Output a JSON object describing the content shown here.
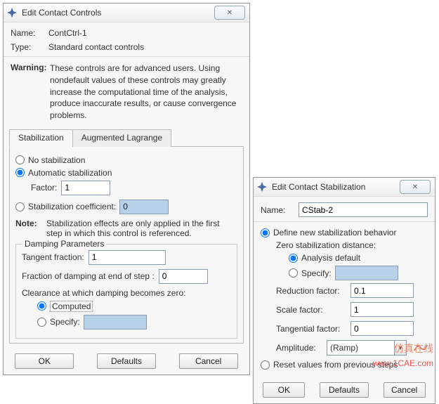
{
  "left": {
    "title": "Edit Contact Controls",
    "name_label": "Name:",
    "name_value": "ContCtrl-1",
    "type_label": "Type:",
    "type_value": "Standard contact controls",
    "warning_label": "Warning:",
    "warning_text": "These controls are for advanced users. Using nondefault values of these controls may greatly increase the computational time of the analysis, produce inaccurate results, or cause convergence problems.",
    "tabs": {
      "stabilization": "Stabilization",
      "augmented": "Augmented Lagrange"
    },
    "opt_none": "No stabilization",
    "opt_auto": "Automatic stabilization",
    "factor_label": "Factor:",
    "factor_value": "1",
    "opt_coef": "Stabilization coefficient:",
    "coef_value": "0",
    "note_label": "Note:",
    "note_text": "Stabilization effects are only applied in the first step in which this control is referenced.",
    "damping_group": "Damping Parameters",
    "tangent_label": "Tangent fraction:",
    "tangent_value": "1",
    "fraction_label": "Fraction of damping at end of step :",
    "fraction_value": "0",
    "clearance_label": "Clearance at which damping becomes zero:",
    "clr_computed": "Computed",
    "clr_specify": "Specify:",
    "clr_specify_value": "",
    "btn_ok": "OK",
    "btn_defaults": "Defaults",
    "btn_cancel": "Cancel"
  },
  "right": {
    "title": "Edit Contact Stabilization",
    "name_label": "Name:",
    "name_value": "CStab-2",
    "opt_define": "Define new stabilization behavior",
    "zero_label": "Zero stabilization distance:",
    "zero_default": "Analysis default",
    "zero_specify": "Specify:",
    "zero_specify_value": "",
    "reduction_label": "Reduction factor:",
    "reduction_value": "0.1",
    "scale_label": "Scale factor:",
    "scale_value": "1",
    "tangential_label": "Tangential factor:",
    "tangential_value": "0",
    "amplitude_label": "Amplitude:",
    "amplitude_value": "(Ramp)",
    "opt_reset": "Reset values from previous steps",
    "btn_ok": "OK",
    "btn_defaults": "Defaults",
    "btn_cancel": "Cancel"
  },
  "misc": {
    "close_glyph": "✕",
    "chevron": "▾",
    "watermark_big": "1CAE",
    "watermark_brand": "仿真在线",
    "watermark_url": "www.1CAE.com"
  }
}
